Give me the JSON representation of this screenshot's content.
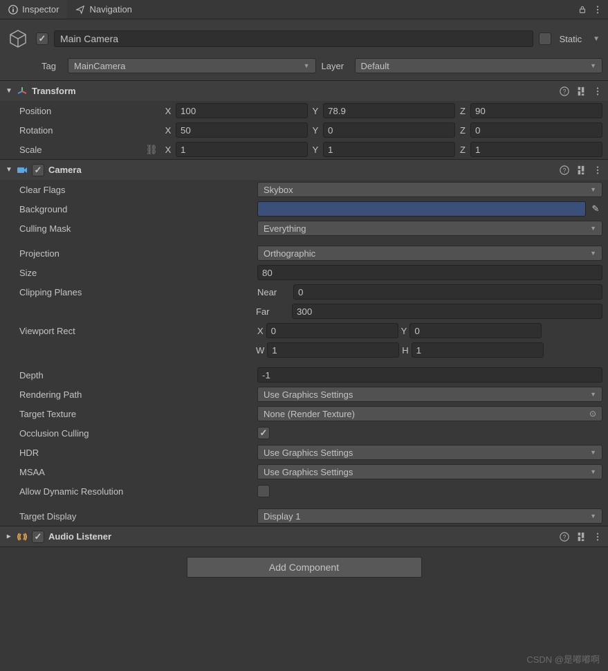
{
  "tabs": {
    "inspector": "Inspector",
    "navigation": "Navigation"
  },
  "header": {
    "name": "Main Camera",
    "static": "Static"
  },
  "tagLayer": {
    "tagLabel": "Tag",
    "tag": "MainCamera",
    "layerLabel": "Layer",
    "layer": "Default"
  },
  "transform": {
    "title": "Transform",
    "position": {
      "label": "Position",
      "x": "100",
      "y": "78.9",
      "z": "90"
    },
    "rotation": {
      "label": "Rotation",
      "x": "50",
      "y": "0",
      "z": "0"
    },
    "scale": {
      "label": "Scale",
      "x": "1",
      "y": "1",
      "z": "1"
    }
  },
  "labels": {
    "X": "X",
    "Y": "Y",
    "Z": "Z",
    "W": "W",
    "H": "H",
    "Near": "Near",
    "Far": "Far"
  },
  "camera": {
    "title": "Camera",
    "clearFlags": {
      "label": "Clear Flags",
      "value": "Skybox"
    },
    "background": {
      "label": "Background",
      "color": "#3a4f7a"
    },
    "cullingMask": {
      "label": "Culling Mask",
      "value": "Everything"
    },
    "projection": {
      "label": "Projection",
      "value": "Orthographic"
    },
    "size": {
      "label": "Size",
      "value": "80"
    },
    "clippingPlanes": {
      "label": "Clipping Planes",
      "near": "0",
      "far": "300"
    },
    "viewportRect": {
      "label": "Viewport Rect",
      "x": "0",
      "y": "0",
      "w": "1",
      "h": "1"
    },
    "depth": {
      "label": "Depth",
      "value": "-1"
    },
    "renderingPath": {
      "label": "Rendering Path",
      "value": "Use Graphics Settings"
    },
    "targetTexture": {
      "label": "Target Texture",
      "value": "None (Render Texture)"
    },
    "occlusionCulling": {
      "label": "Occlusion Culling"
    },
    "hdr": {
      "label": "HDR",
      "value": "Use Graphics Settings"
    },
    "msaa": {
      "label": "MSAA",
      "value": "Use Graphics Settings"
    },
    "allowDynamicResolution": {
      "label": "Allow Dynamic Resolution"
    },
    "targetDisplay": {
      "label": "Target Display",
      "value": "Display 1"
    }
  },
  "audioListener": {
    "title": "Audio Listener"
  },
  "addComponent": "Add Component",
  "watermark": "CSDN @是嘟嘟啊"
}
